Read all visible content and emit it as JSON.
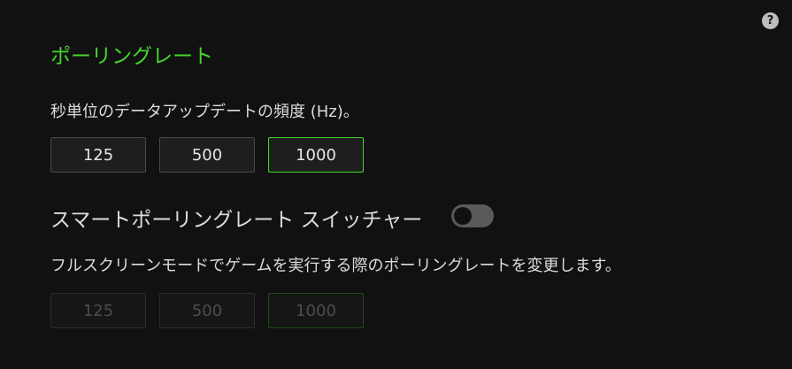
{
  "help": {
    "icon": "question-mark-icon",
    "glyph": "?"
  },
  "polling": {
    "title": "ポーリングレート",
    "description": "秒単位のデータアップデートの頻度 (Hz)。",
    "options": [
      "125",
      "500",
      "1000"
    ],
    "selected": "1000"
  },
  "smart_switch": {
    "label": "スマートポーリングレート スイッチャー",
    "enabled": false,
    "description": "フルスクリーンモードでゲームを実行する際のポーリングレートを変更します。",
    "options": [
      "125",
      "500",
      "1000"
    ],
    "selected": "1000"
  },
  "colors": {
    "accent": "#44d62c",
    "background": "#111111",
    "text": "#dcdcdc",
    "disabled_text": "#4d4d4d"
  }
}
